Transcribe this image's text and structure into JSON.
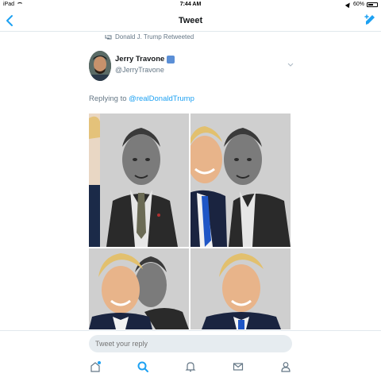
{
  "status_bar": {
    "device": "iPad",
    "time": "7:44 AM",
    "battery": "60%"
  },
  "nav": {
    "title": "Tweet"
  },
  "tweet": {
    "retweeted_by": "Donald J. Trump Retweeted",
    "author_name": "Jerry Travone",
    "author_handle": "@JerryTravone",
    "replying_prefix": "Replying to ",
    "replying_to": "@realDonaldTrump"
  },
  "composer": {
    "placeholder": "Tweet your reply"
  },
  "tab_bar": {
    "items": [
      "home",
      "search",
      "notifications",
      "messages",
      "profile"
    ],
    "active": "search"
  },
  "colors": {
    "accent": "#1da1f2",
    "secondary_text": "#657786",
    "border": "#e1e8ed"
  },
  "icons": [
    "wifi-icon",
    "location-icon",
    "battery-icon",
    "back-icon",
    "compose-icon",
    "retweet-icon",
    "chevron-down-icon",
    "home-icon",
    "search-icon",
    "bell-icon",
    "envelope-icon",
    "person-icon"
  ]
}
